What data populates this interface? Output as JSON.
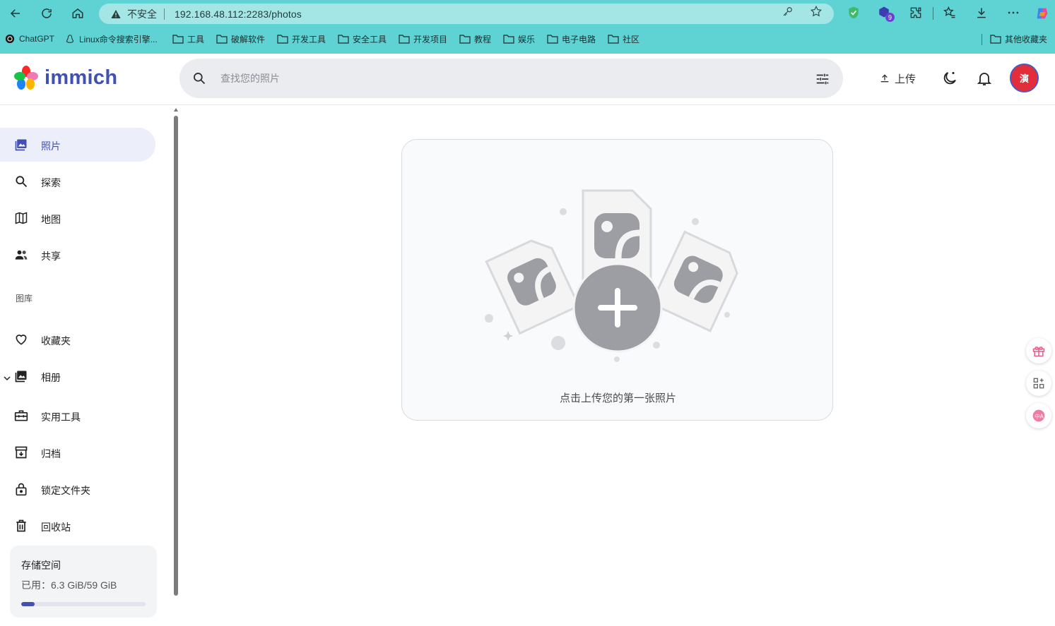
{
  "browser": {
    "security_label": "不安全",
    "url": "192.168.48.112:2283/photos",
    "extension_badge": "9",
    "bookmarks": [
      {
        "label": "ChatGPT"
      },
      {
        "label": "Linux命令搜索引擎..."
      },
      {
        "label": "工具"
      },
      {
        "label": "破解软件"
      },
      {
        "label": "开发工具"
      },
      {
        "label": "安全工具"
      },
      {
        "label": "开发项目"
      },
      {
        "label": "教程"
      },
      {
        "label": "娱乐"
      },
      {
        "label": "电子电路"
      },
      {
        "label": "社区"
      }
    ],
    "other_bookmarks": "其他收藏夹"
  },
  "header": {
    "logo_text": "immich",
    "search_placeholder": "查找您的照片",
    "upload_label": "上传",
    "avatar_initial": "演"
  },
  "sidebar": {
    "items": [
      {
        "label": "照片",
        "icon": "photos-icon"
      },
      {
        "label": "探索",
        "icon": "search-icon"
      },
      {
        "label": "地图",
        "icon": "map-icon"
      },
      {
        "label": "共享",
        "icon": "sharing-icon"
      }
    ],
    "library_label": "图库",
    "library_items": [
      {
        "label": "收藏夹",
        "icon": "heart-icon"
      },
      {
        "label": "相册",
        "icon": "album-icon"
      },
      {
        "label": "实用工具",
        "icon": "toolbox-icon"
      },
      {
        "label": "归档",
        "icon": "archive-icon"
      },
      {
        "label": "锁定文件夹",
        "icon": "lock-icon"
      },
      {
        "label": "回收站",
        "icon": "trash-icon"
      }
    ],
    "storage": {
      "title": "存储空间",
      "used_text": "已用：6.3 GiB/59 GiB",
      "used_fraction": 0.107
    }
  },
  "main": {
    "empty_message": "点击上传您的第一张照片"
  },
  "colors": {
    "accent": "#4250af",
    "avatar_bg": "#e12e3a",
    "chrome_bg": "#5fd3d3"
  }
}
